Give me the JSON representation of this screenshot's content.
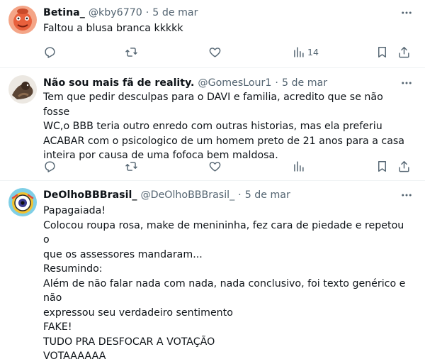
{
  "tweets": [
    {
      "name": "Betina_",
      "handle": "@kby6770",
      "separator": "·",
      "date": "5 de mar",
      "lines": [
        "Faltou a blusa branca kkkkk"
      ],
      "views": "14",
      "avatar_icon": "profile-photo-icon"
    },
    {
      "name": "Não sou mais fã de reality.",
      "handle": "@GomesLour1",
      "separator": "·",
      "date": "5 de mar",
      "lines": [
        "Tem que pedir desculpas para o DAVI e familia, acredito que se não fosse",
        "WC,o BBB teria outro enredo com outras historias, mas ela preferiu",
        "ACABAR com o psicologico de um homem preto de 21 anos para a casa",
        "inteira por causa de uma fofoca bem maldosa."
      ],
      "views": "",
      "avatar_icon": "profile-photo-icon"
    },
    {
      "name": "DeOlhoBBBrasil_",
      "handle": "@DeOlhoBBBrasil_",
      "separator": "·",
      "date": "5 de mar",
      "lines": [
        "Papagaiada!",
        "Colocou roupa rosa, make de menininha, fez cara de piedade e repetou o",
        "que os assessores mandaram...",
        "Resumindo:",
        "Além de não falar nada com nada, nada conclusivo, foi texto genérico e não",
        "expressou seu verdadeiro sentimento",
        "FAKE!",
        "TUDO PRA DESFOCAR A VOTAÇÃO",
        "VOTAAAAAA"
      ],
      "avatar_icon": "profile-photo-icon"
    }
  ],
  "colors": {
    "text": "#0f1419",
    "secondary": "#536471",
    "divider": "#eff3f4"
  },
  "icons": [
    "reply-icon",
    "retweet-icon",
    "like-icon",
    "views-icon",
    "bookmark-icon",
    "share-icon",
    "more-icon"
  ]
}
